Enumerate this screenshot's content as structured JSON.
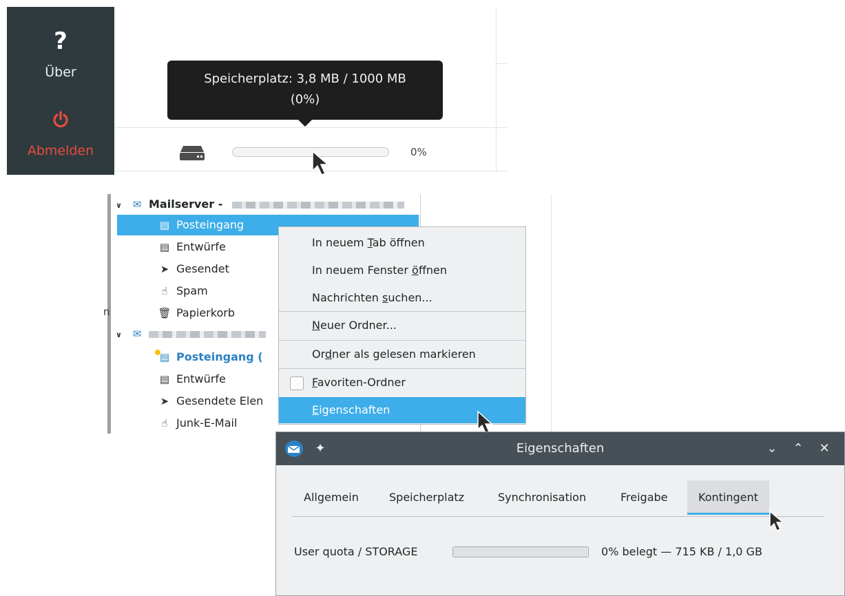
{
  "sidebar": {
    "about_icon": "?",
    "about_label": "Über",
    "logout_icon": "power-icon",
    "logout_label": "Abmelden",
    "logout_color": "#e74c3c"
  },
  "storage": {
    "tooltip_line1": "Speicherplatz: 3,8 MB / 1000 MB",
    "tooltip_line2": "(0%)",
    "percent_label": "0%",
    "used_fraction": 0
  },
  "tree": {
    "accounts": [
      {
        "name": "Mailserver -",
        "folders": [
          {
            "label": "Posteingang",
            "icon": "inbox-icon",
            "selected": true
          },
          {
            "label": "Entwürfe",
            "icon": "drafts-icon"
          },
          {
            "label": "Gesendet",
            "icon": "sent-icon"
          },
          {
            "label": "Spam",
            "icon": "spam-icon"
          },
          {
            "label": "Papierkorb",
            "icon": "trash-icon"
          }
        ]
      },
      {
        "name": "",
        "folders": [
          {
            "label": "Posteingang (",
            "icon": "inbox-icon",
            "unread": true
          },
          {
            "label": "Entwürfe",
            "icon": "drafts-icon"
          },
          {
            "label": "Gesendete Elen",
            "icon": "sent-icon"
          },
          {
            "label": "Junk-E-Mail",
            "icon": "spam-icon"
          }
        ]
      }
    ]
  },
  "context_menu": {
    "open_tab_pre": "In neuem ",
    "open_tab_key": "T",
    "open_tab_post": "ab öffnen",
    "open_window_pre": "In neuem Fenster ",
    "open_window_key": "ö",
    "open_window_post": "ffnen",
    "search_pre": "Nachrichten ",
    "search_key": "s",
    "search_post": "uchen...",
    "new_folder_key": "N",
    "new_folder_post": "euer Ordner...",
    "mark_read_pre": "Or",
    "mark_read_key": "d",
    "mark_read_post": "ner als gelesen markieren",
    "favorite_key": "F",
    "favorite_post": "avoriten-Ordner",
    "properties_key": "E",
    "properties_post": "igenschaften"
  },
  "dialog": {
    "title": "Eigenschaften",
    "tabs": [
      "Allgemein",
      "Speicherplatz",
      "Synchronisation",
      "Freigabe",
      "Kontingent"
    ],
    "active_tab": "Kontingent",
    "quota_label": "User quota / STORAGE",
    "quota_text": "0% belegt — 715 KB / 1,0 GB",
    "quota_fraction": 0
  },
  "colors": {
    "accent": "#3daee9",
    "dark_sidebar": "#2f3a3f",
    "titlebar": "#475057"
  }
}
